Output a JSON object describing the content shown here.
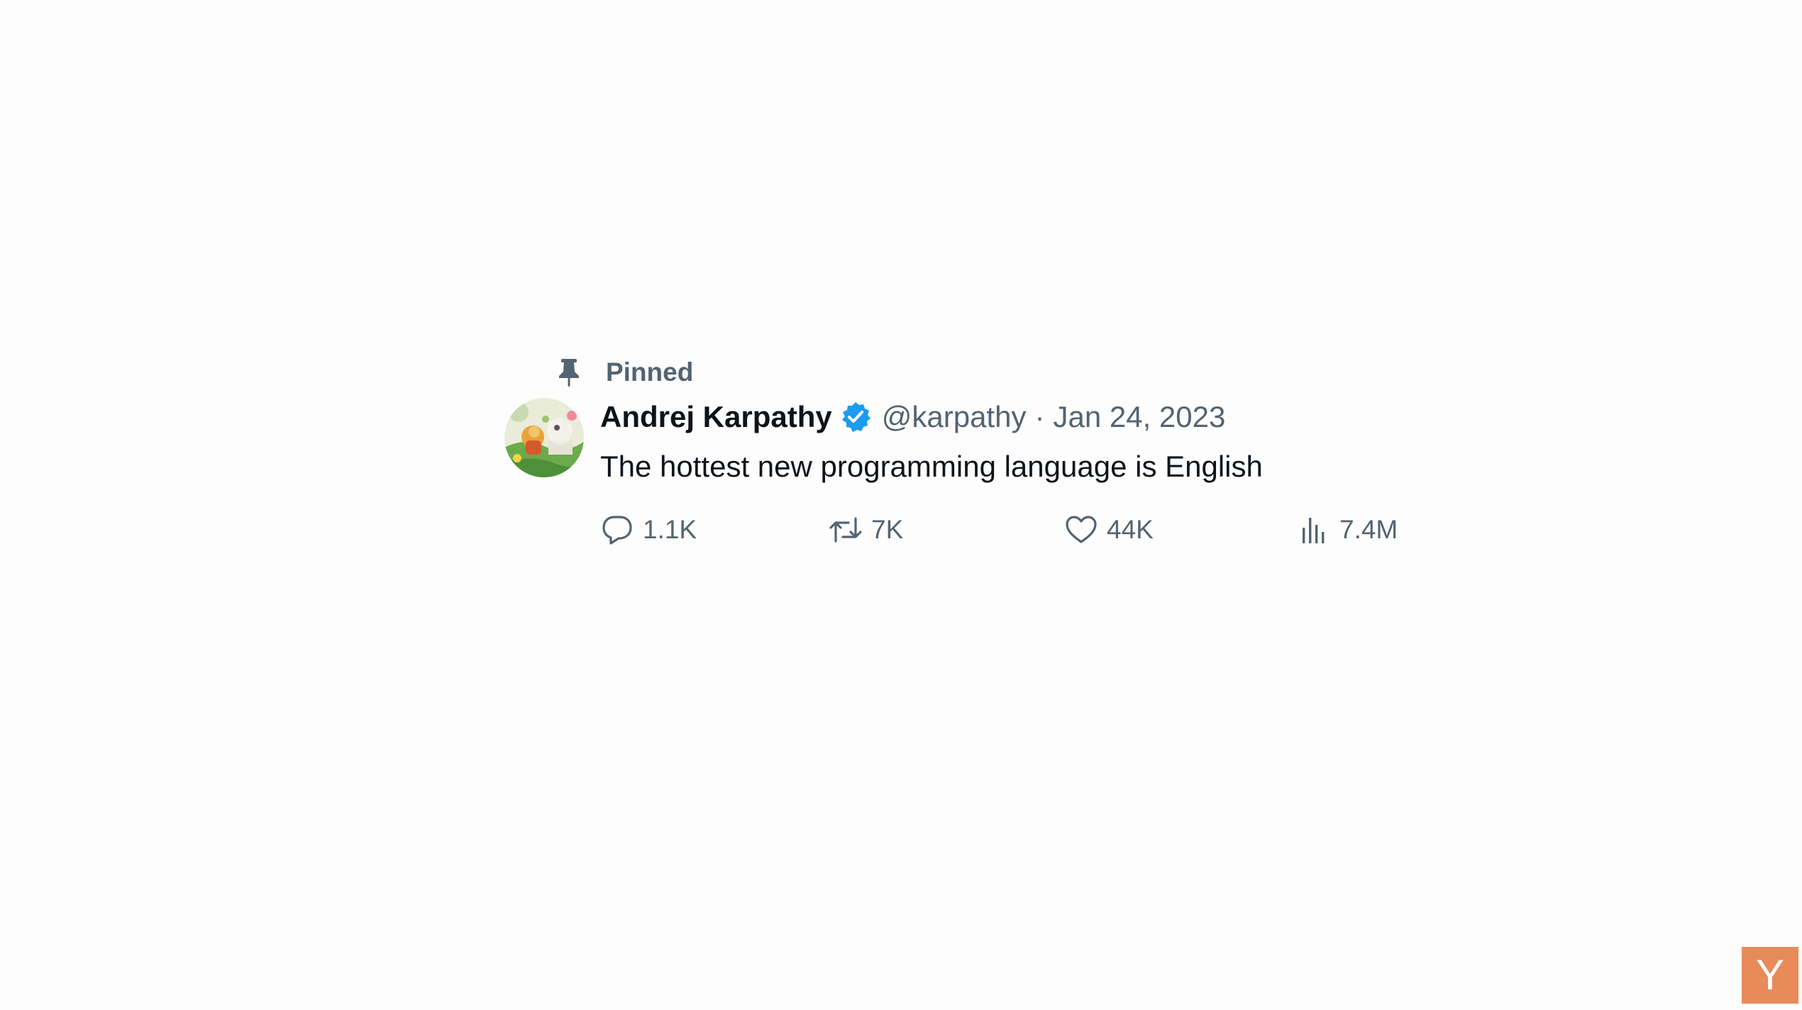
{
  "tweet": {
    "pinned_label": "Pinned",
    "display_name": "Andrej Karpathy",
    "handle": "@karpathy",
    "separator": "·",
    "date": "Jan 24, 2023",
    "text": "The hottest new programming language is English",
    "verified_color": "#1d9bf0"
  },
  "actions": {
    "replies": "1.1K",
    "reposts": "7K",
    "likes": "44K",
    "views": "7.4M"
  },
  "icons": {
    "pin": "pin-icon",
    "verified": "verified-badge-icon",
    "reply": "reply-icon",
    "repost": "repost-icon",
    "like": "heart-icon",
    "views": "bar-chart-icon"
  },
  "watermark": {
    "letter": "Y",
    "color": "#e98a5a"
  }
}
